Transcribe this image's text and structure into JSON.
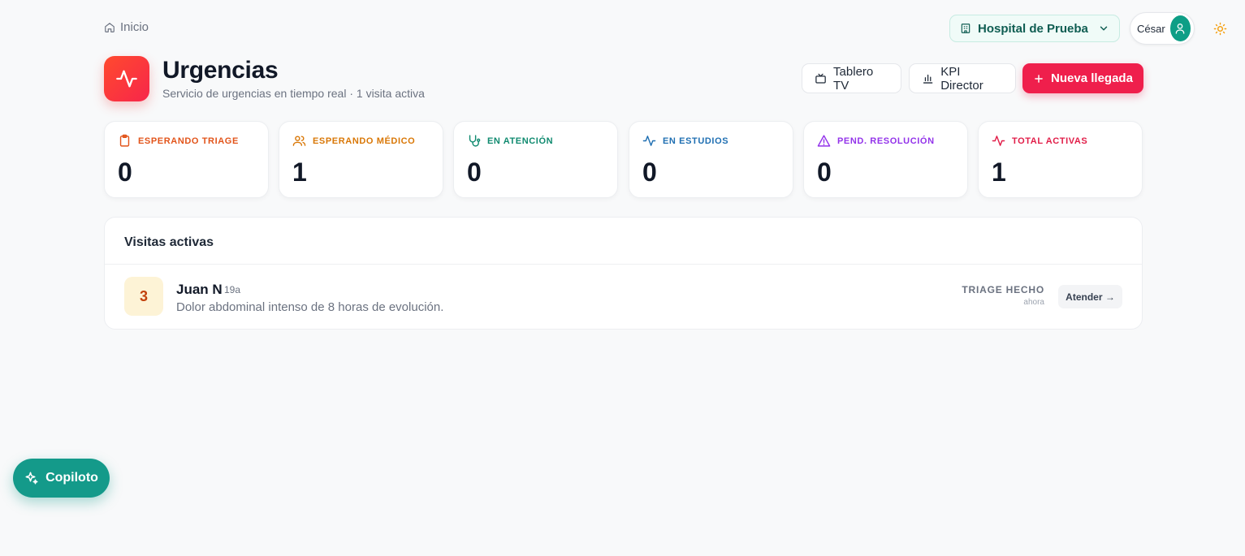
{
  "breadcrumb": {
    "icon": "home-icon",
    "label": "Inicio"
  },
  "topbar": {
    "hospital": {
      "label": "Hospital de Prueba ...",
      "icon": "building-icon"
    },
    "user": {
      "name": "César",
      "icon": "user-icon"
    },
    "theme": {
      "icon": "sun-icon"
    }
  },
  "header": {
    "icon": "activity-icon",
    "title": "Urgencias",
    "subtitle": "Servicio de urgencias en tiempo real · 1 visita activa",
    "buttons": {
      "tv": "Tablero TV",
      "kpi": "KPI Director",
      "new": "Nueva llegada"
    }
  },
  "stats": [
    {
      "label": "ESPERANDO TRIAGE",
      "value": "0",
      "color": "#e2541a",
      "icon": "clipboard-icon"
    },
    {
      "label": "ESPERANDO MÉDICO",
      "value": "1",
      "color": "#d97706",
      "icon": "users-icon"
    },
    {
      "label": "EN ATENCIÓN",
      "value": "0",
      "color": "#0f8a6f",
      "icon": "stethoscope-icon"
    },
    {
      "label": "EN ESTUDIOS",
      "value": "0",
      "color": "#1f6fb2",
      "icon": "activity-icon"
    },
    {
      "label": "PEND. RESOLUCIÓN",
      "value": "0",
      "color": "#9333ea",
      "icon": "alert-triangle-icon"
    },
    {
      "label": "TOTAL ACTIVAS",
      "value": "1",
      "color": "#e11d48",
      "icon": "activity-icon"
    }
  ],
  "visits": {
    "title": "Visitas activas",
    "items": [
      {
        "triage_level": "3",
        "name": "Juan N",
        "age": "19a",
        "complaint": "Dolor abdominal intenso de 8 horas de evolución.",
        "status": "TRIAGE HECHO",
        "time": "ahora",
        "action": "Atender →"
      }
    ]
  },
  "copilot": {
    "label": "Copiloto",
    "icon": "sparkles-icon"
  }
}
